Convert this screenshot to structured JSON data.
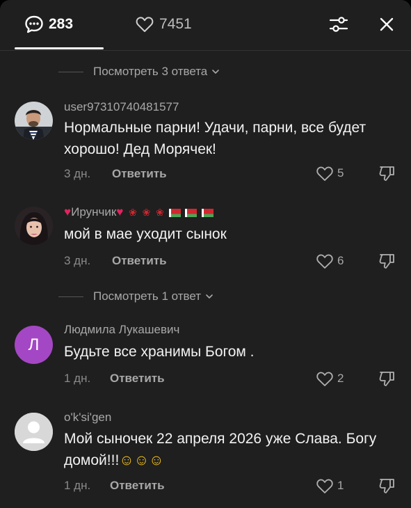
{
  "header": {
    "comments_count": "283",
    "likes_count": "7451"
  },
  "view_replies": [
    "Посмотреть 3 ответа",
    "Посмотреть 1 ответ"
  ],
  "comments": [
    {
      "username": "user97310740481577",
      "text": "Нормальные парни! Удачи, парни, все будет хорошо! Дед Морячек!",
      "time": "3 дн.",
      "reply_label": "Ответить",
      "likes": "5"
    },
    {
      "username": "Ирунчик",
      "text": "мой в мае уходит сынок",
      "time": "3 дн.",
      "reply_label": "Ответить",
      "likes": "6"
    },
    {
      "username": "Людмила Лукашевич",
      "avatar_letter": "Л",
      "text": "Будьте все хранимы Богом .",
      "time": "1 дн.",
      "reply_label": "Ответить",
      "likes": "2"
    },
    {
      "username": "o'k'si'gen",
      "text": "Мой сыночек 22 апреля 2026 уже Слава. Богу домой!!!",
      "time": "1 дн.",
      "reply_label": "Ответить",
      "likes": "1"
    }
  ],
  "colors": {
    "background": "#1f1f1f",
    "text_primary": "#f2f2f2",
    "text_secondary": "#a8a8a8",
    "avatar_letter_bg": "#a447c4"
  },
  "icons": {
    "comments": "comment-bubble-icon",
    "likes": "heart-outline-icon",
    "filter": "sliders-icon",
    "close": "close-icon",
    "like": "heart-outline-icon",
    "dislike": "thumb-down-icon",
    "chevron": "chevron-down-icon"
  }
}
